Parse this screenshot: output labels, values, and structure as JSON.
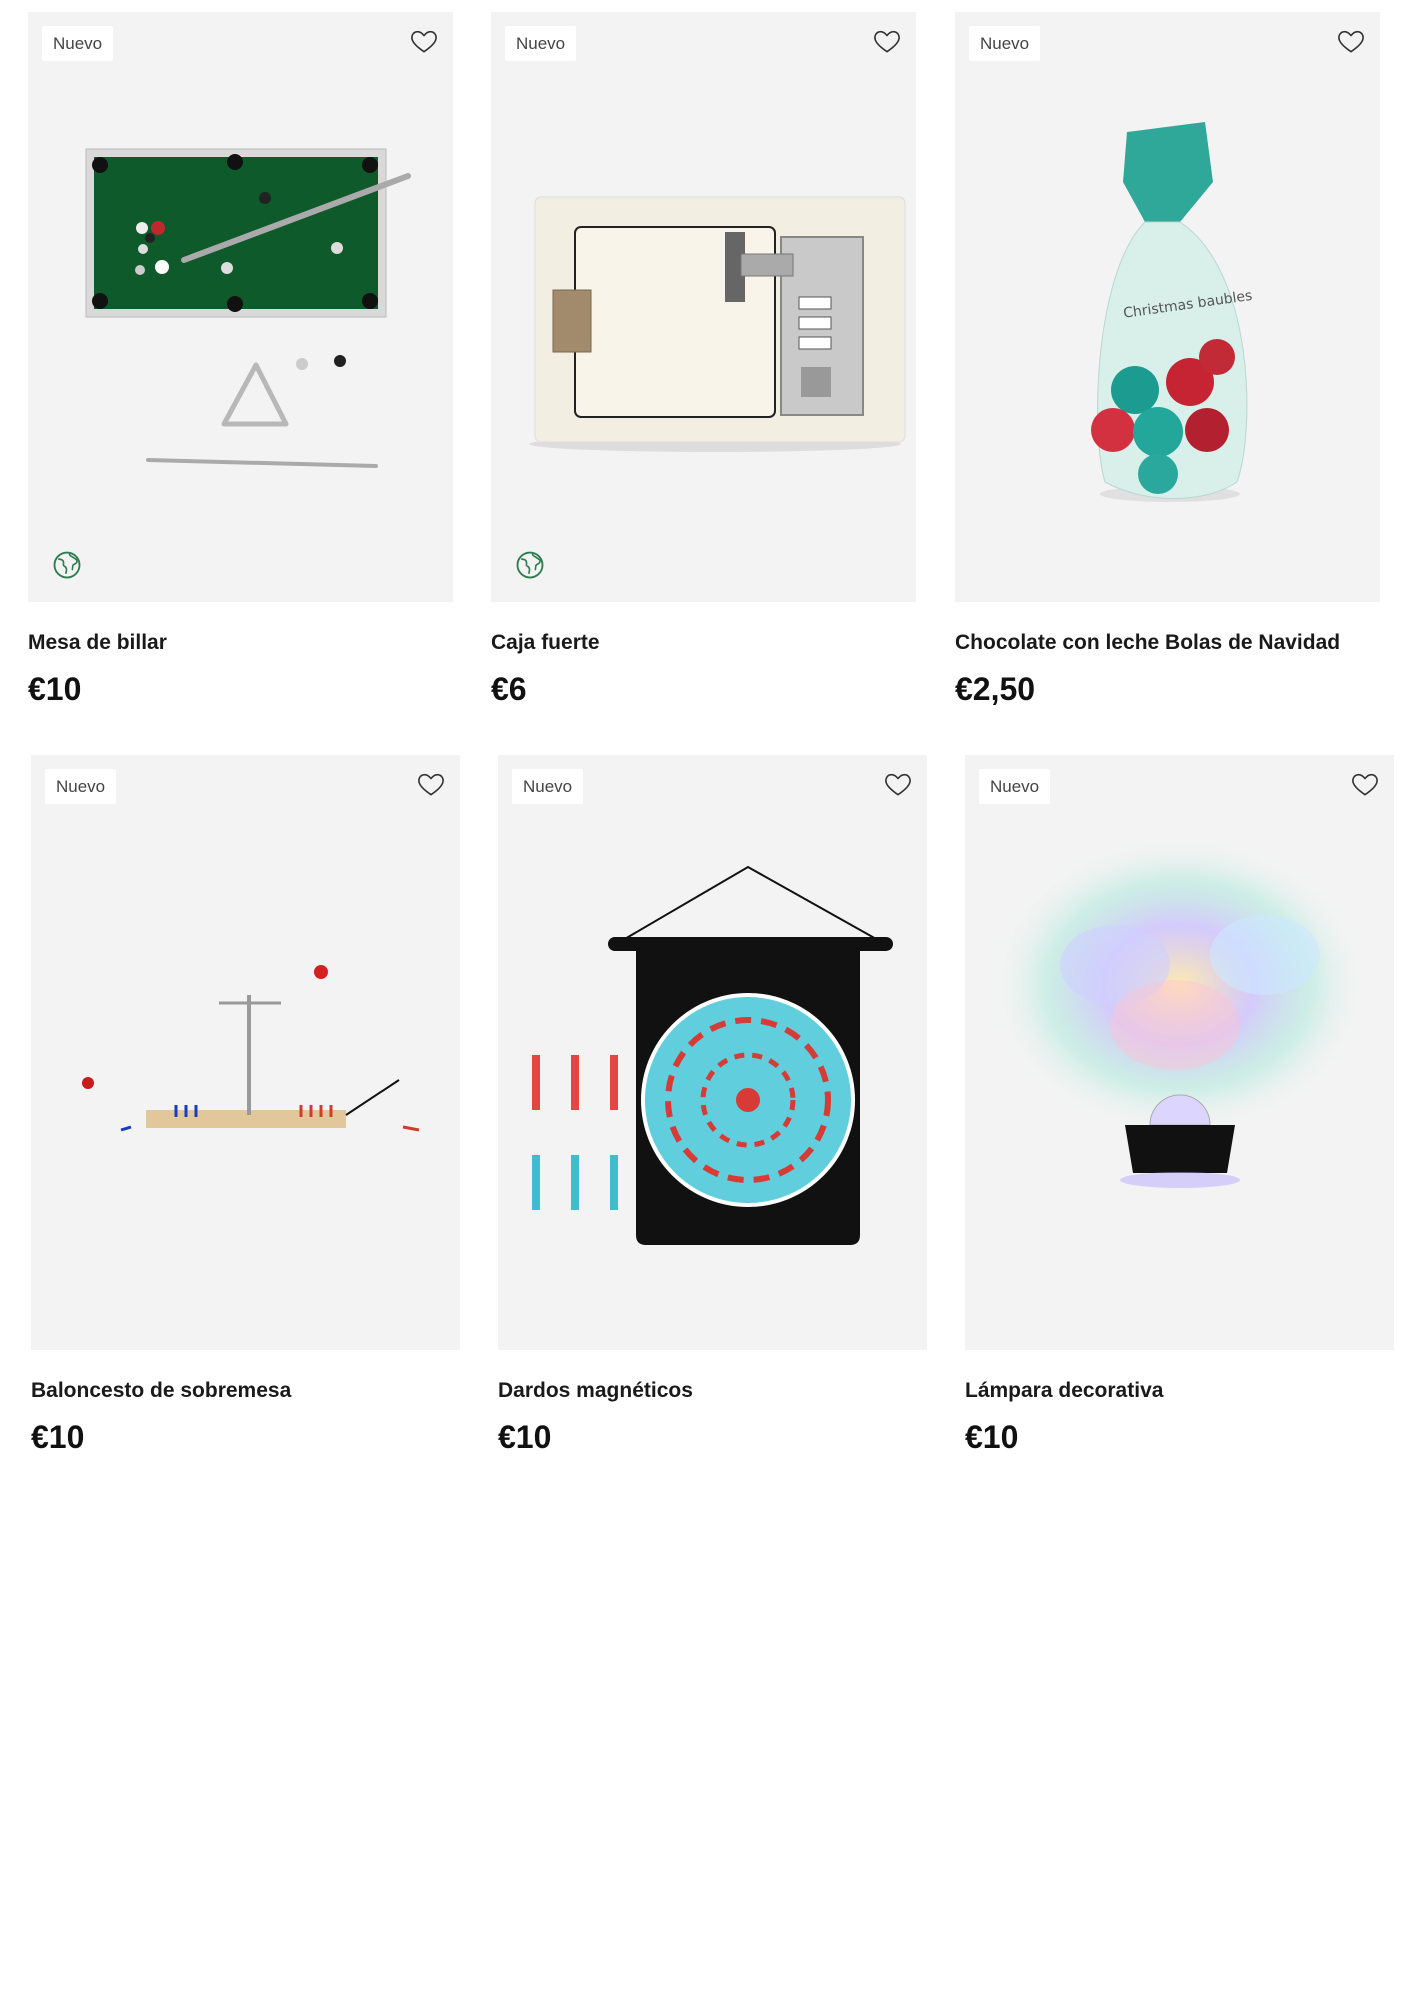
{
  "colors": {
    "card_bg": "#f3f3f3",
    "badge_bg": "#ffffff",
    "eco_green": "#2e7d4f"
  },
  "products": [
    {
      "name": "Mesa de billar",
      "price": "€10",
      "badge": "Nuevo",
      "image": "pool-table-image",
      "eco": true
    },
    {
      "name": "Caja fuerte",
      "price": "€6",
      "badge": "Nuevo",
      "image": "safe-box-image",
      "eco": true
    },
    {
      "name": "Chocolate con leche Bolas de Navidad",
      "price": "€2,50",
      "badge": "Nuevo",
      "image": "chocolate-baubles-image",
      "eco": false,
      "image_text": "Christmas baubles"
    },
    {
      "name": "Baloncesto de sobremesa",
      "price": "€10",
      "badge": "Nuevo",
      "image": "tabletop-basketball-image",
      "eco": false
    },
    {
      "name": "Dardos magnéticos",
      "price": "€10",
      "badge": "Nuevo",
      "image": "magnetic-darts-image",
      "eco": false
    },
    {
      "name": "Lámpara decorativa",
      "price": "€10",
      "badge": "Nuevo",
      "image": "disco-lamp-image",
      "eco": false
    }
  ]
}
